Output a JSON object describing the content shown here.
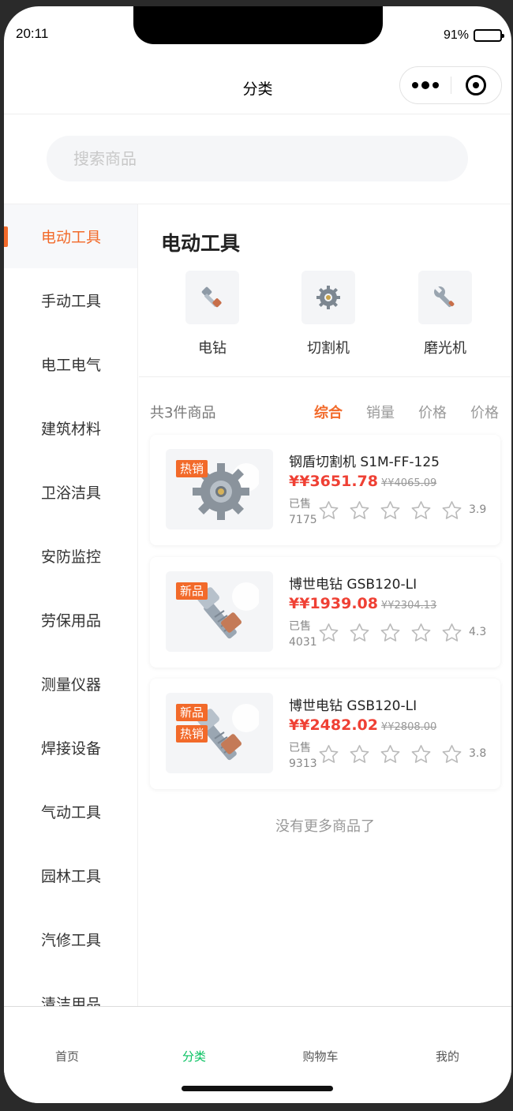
{
  "status_bar": {
    "time": "20:11",
    "battery": "91%",
    "battery_level": 0.91
  },
  "nav": {
    "title": "分类"
  },
  "search": {
    "placeholder": "搜索商品"
  },
  "sidebar": {
    "items": [
      {
        "label": "电动工具",
        "active": true
      },
      {
        "label": "手动工具"
      },
      {
        "label": "电工电气"
      },
      {
        "label": "建筑材料"
      },
      {
        "label": "卫浴洁具"
      },
      {
        "label": "安防监控"
      },
      {
        "label": "劳保用品"
      },
      {
        "label": "测量仪器"
      },
      {
        "label": "焊接设备"
      },
      {
        "label": "气动工具"
      },
      {
        "label": "园林工具"
      },
      {
        "label": "汽修工具"
      },
      {
        "label": "清洁用品"
      }
    ]
  },
  "category": {
    "title": "电动工具",
    "subcategories": [
      {
        "label": "电钻",
        "icon": "bolt-nut-icon"
      },
      {
        "label": "切割机",
        "icon": "gear-icon"
      },
      {
        "label": "磨光机",
        "icon": "wrench-icon"
      }
    ]
  },
  "sortbar": {
    "count_text": "共3件商品",
    "options": [
      "综合",
      "销量",
      "价格",
      "价格"
    ],
    "active_index": 0
  },
  "products": [
    {
      "name": "钢盾切割机 S1M-FF-125",
      "price": "¥¥3651.78",
      "original_price": "¥¥4065.09",
      "sold_label": "已售",
      "sold": "7175",
      "rating": "3.9",
      "badges": [
        "热销"
      ],
      "image": "gear-icon"
    },
    {
      "name": "博世电钻 GSB120-LI",
      "price": "¥¥1939.08",
      "original_price": "¥¥2304.13",
      "sold_label": "已售",
      "sold": "4031",
      "rating": "4.3",
      "badges": [
        "新品"
      ],
      "image": "bolt-nut-icon"
    },
    {
      "name": "博世电钻 GSB120-LI",
      "price": "¥¥2482.02",
      "original_price": "¥¥2808.00",
      "sold_label": "已售",
      "sold": "9313",
      "rating": "3.8",
      "badges": [
        "新品",
        "热销"
      ],
      "image": "bolt-nut-icon"
    }
  ],
  "no_more_text": "没有更多商品了",
  "tabbar": {
    "tabs": [
      {
        "label": "首页"
      },
      {
        "label": "分类",
        "active": true
      },
      {
        "label": "购物车"
      },
      {
        "label": "我的"
      }
    ]
  },
  "colors": {
    "accent": "#f26a2a",
    "price": "#ef4034",
    "tab_active": "#07c160"
  }
}
